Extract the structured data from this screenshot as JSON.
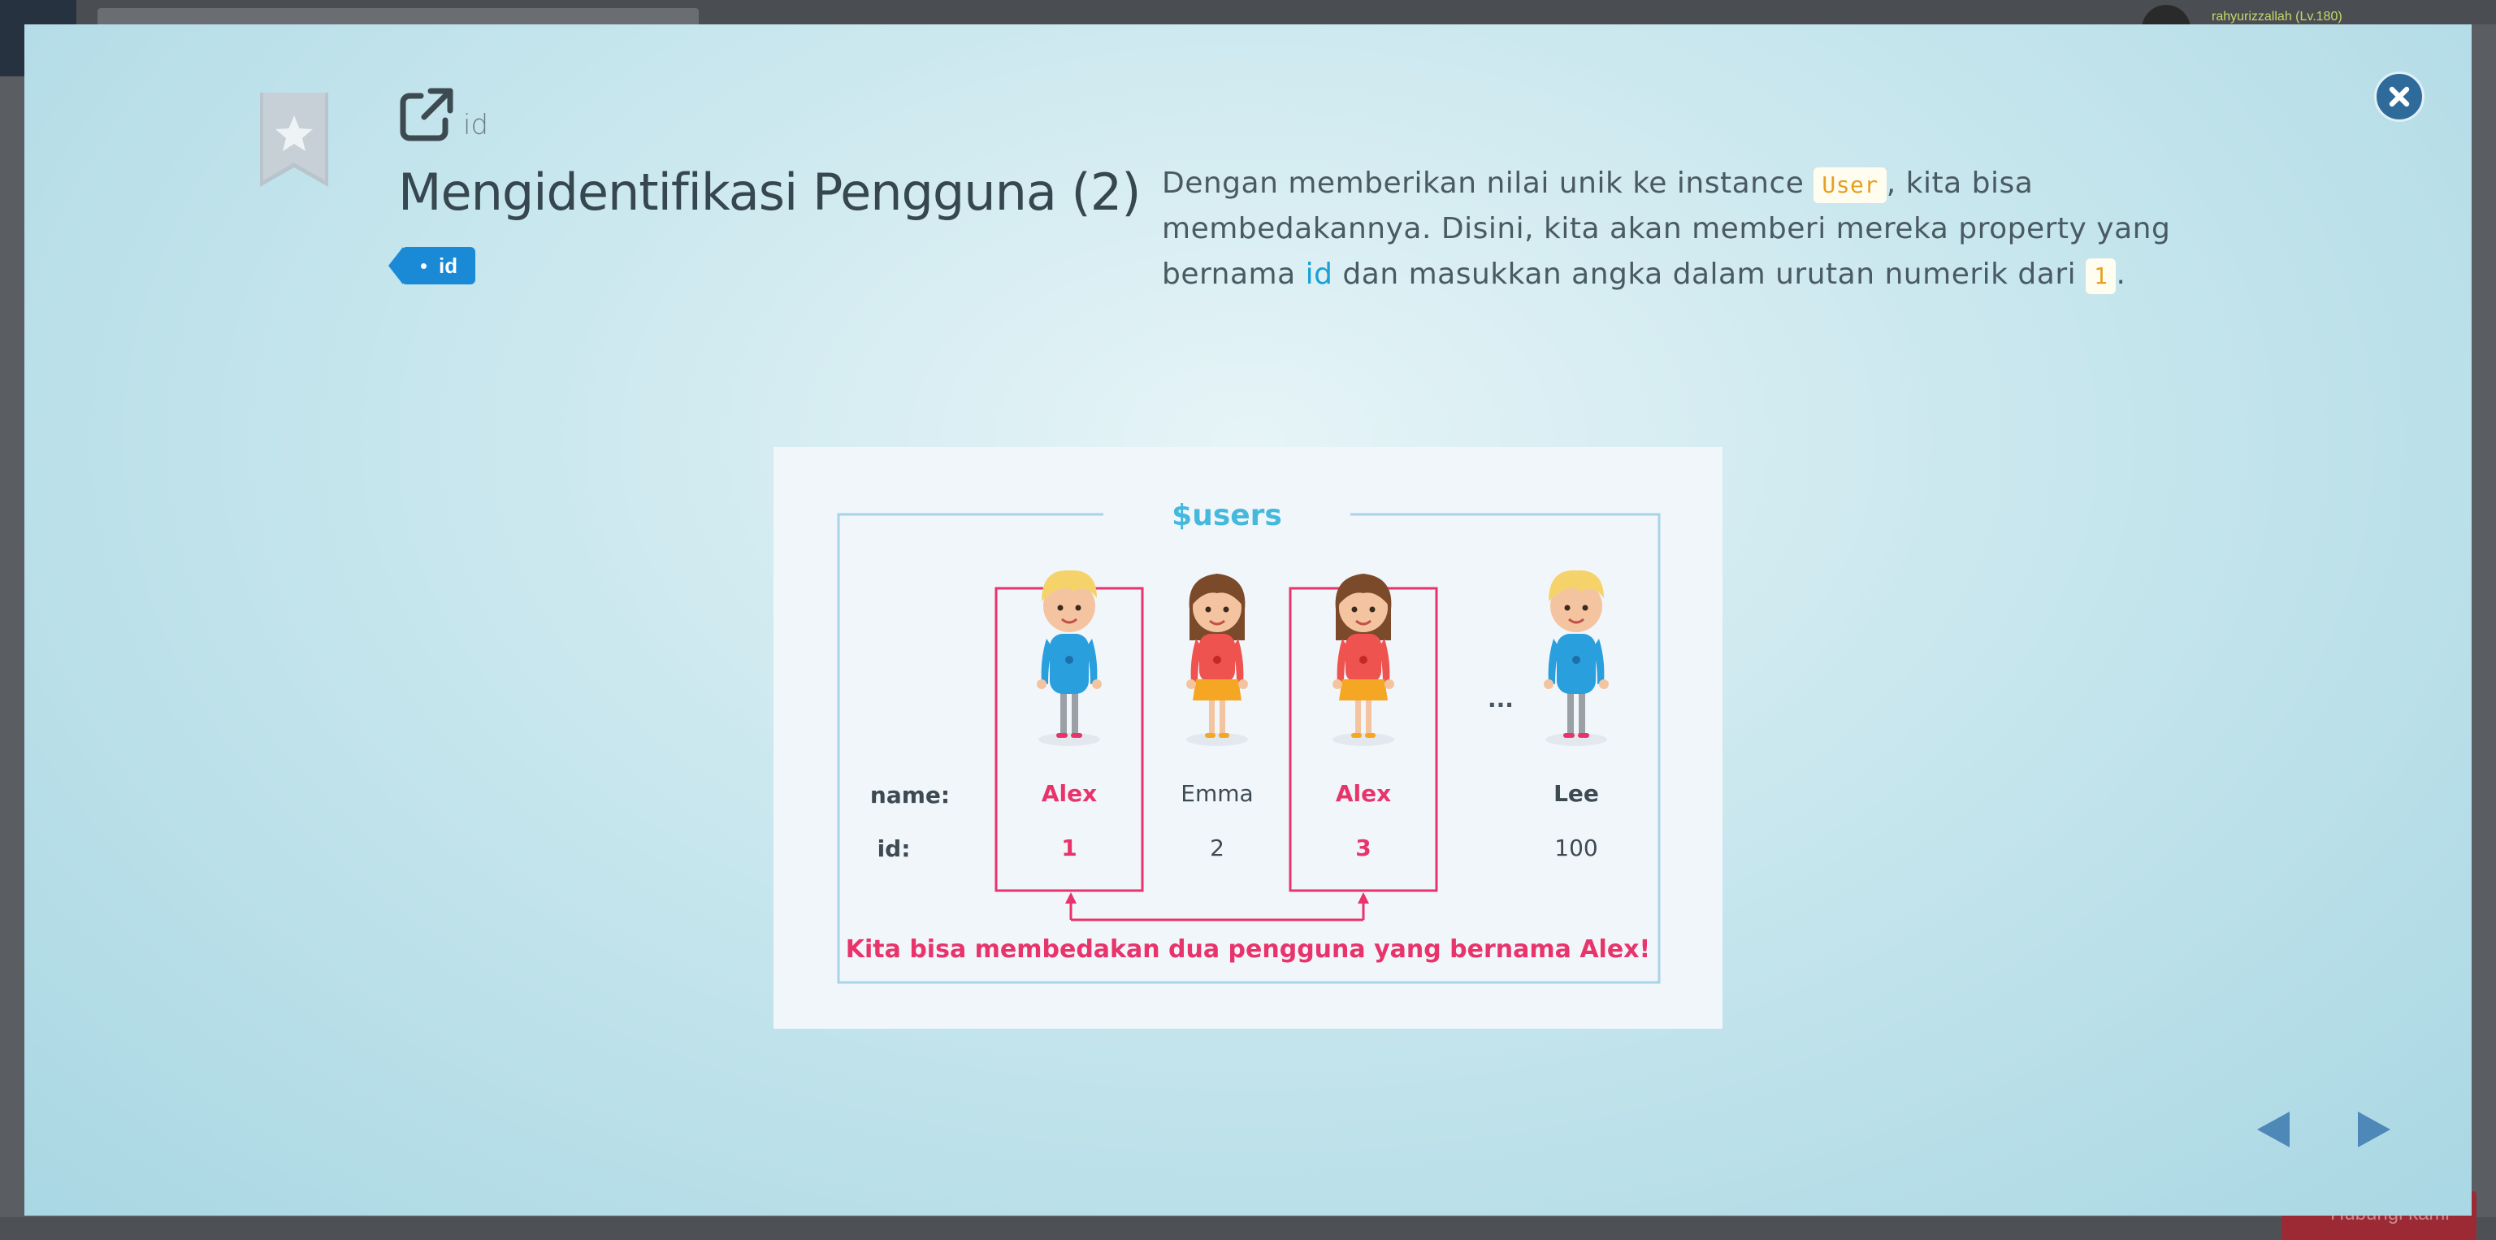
{
  "background": {
    "user_label": "rahyurizzallah (Lv.180)",
    "bottom_button_label": "Hubungi kami"
  },
  "modal": {
    "external_label": "id",
    "title": "Mengidentifikasi Pengguna (2)",
    "tag_label": "id",
    "description": {
      "part1": "Dengan memberikan nilai unik ke instance ",
      "code1": "User",
      "part2": ", kita bisa membedakannya. Disini, kita akan memberi mereka property yang bernama ",
      "highlight": "id",
      "part3": " dan masukkan angka dalam urutan numerik dari ",
      "code2": "1",
      "part4": "."
    }
  },
  "figure": {
    "group_title": "$users",
    "row_labels": {
      "name": "name:",
      "id": "id:"
    },
    "users": [
      {
        "name": "Alex",
        "id": "1",
        "type": "boy",
        "highlighted": true
      },
      {
        "name": "Emma",
        "id": "2",
        "type": "girl",
        "highlighted": false
      },
      {
        "name": "Alex",
        "id": "3",
        "type": "girl",
        "highlighted": true
      },
      {
        "name": "Lee",
        "id": "100",
        "type": "boy",
        "highlighted": false
      }
    ],
    "ellipsis": "...",
    "caption": "Kita bisa membedakan dua pengguna yang bernama Alex!"
  },
  "colors": {
    "accent": "#e8336b",
    "title_blue": "#45b9dc",
    "tag_blue": "#1a8ad6",
    "close_button": "#2e6a9a",
    "nav_arrows": "#4d88b8"
  },
  "icons": {
    "bookmark": "bookmark-star-icon",
    "external": "external-link-icon",
    "close": "close-icon",
    "prev": "prev-arrow-icon",
    "next": "next-arrow-icon"
  }
}
